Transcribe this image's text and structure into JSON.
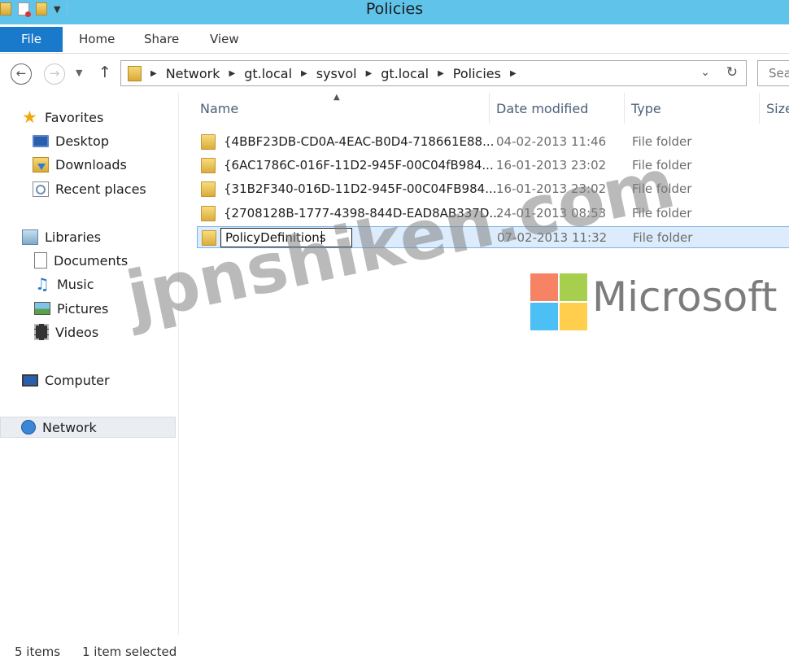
{
  "window": {
    "title": "Policies"
  },
  "quick_access": {
    "folder_icon": "folder-icon",
    "properties_icon": "properties-icon",
    "new_folder_icon": "new-folder-icon",
    "customize_icon": "chevron-down-icon"
  },
  "ribbon": {
    "file_label": "File",
    "tabs": [
      {
        "label": "Home"
      },
      {
        "label": "Share"
      },
      {
        "label": "View"
      }
    ]
  },
  "address": {
    "breadcrumbs": [
      "Network",
      "gt.local",
      "sysvol",
      "gt.local",
      "Policies"
    ],
    "search_placeholder": "Sea"
  },
  "navigation": {
    "favorites_label": "Favorites",
    "favorites": [
      {
        "label": "Desktop",
        "icon": "desktop-icon"
      },
      {
        "label": "Downloads",
        "icon": "downloads-icon"
      },
      {
        "label": "Recent places",
        "icon": "recent-places-icon"
      }
    ],
    "libraries_label": "Libraries",
    "libraries": [
      {
        "label": "Documents",
        "icon": "documents-icon"
      },
      {
        "label": "Music",
        "icon": "music-icon"
      },
      {
        "label": "Pictures",
        "icon": "pictures-icon"
      },
      {
        "label": "Videos",
        "icon": "videos-icon"
      }
    ],
    "computer_label": "Computer",
    "network_label": "Network"
  },
  "file_list": {
    "columns": [
      "Name",
      "Date modified",
      "Type",
      "Size"
    ],
    "rows": [
      {
        "name": "{4BBF23DB-CD0A-4EAC-B0D4-718661E88...",
        "date": "04-02-2013 11:46",
        "type": "File folder"
      },
      {
        "name": "{6AC1786C-016F-11D2-945F-00C04fB984...",
        "date": "16-01-2013 23:02",
        "type": "File folder"
      },
      {
        "name": "{31B2F340-016D-11D2-945F-00C04FB984...",
        "date": "16-01-2013 23:02",
        "type": "File folder"
      },
      {
        "name": "{2708128B-1777-4398-844D-EAD8AB337D...",
        "date": "24-01-2013 08:53",
        "type": "File folder"
      },
      {
        "name": "PolicyDefinitions",
        "date": "07-02-2013 11:32",
        "type": "File folder",
        "renaming": true
      }
    ]
  },
  "watermark": {
    "site": "jpnshiken.com",
    "brand": "Microsoft"
  },
  "status_bar": {
    "item_count": "5 items",
    "selection": "1 item selected"
  },
  "colors": {
    "title_bar": "#5fc3ea",
    "file_tab": "#1979ca",
    "selection": "#dcecfc",
    "header_text": "#4c607a"
  }
}
